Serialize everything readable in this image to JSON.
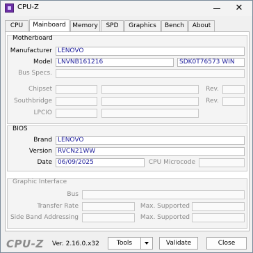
{
  "window": {
    "title": "CPU-Z",
    "close_glyph": "✕"
  },
  "tabs": [
    {
      "label": "CPU"
    },
    {
      "label": "Mainboard"
    },
    {
      "label": "Memory"
    },
    {
      "label": "SPD"
    },
    {
      "label": "Graphics"
    },
    {
      "label": "Bench"
    },
    {
      "label": "About"
    }
  ],
  "motherboard": {
    "title": "Motherboard",
    "manufacturer_label": "Manufacturer",
    "manufacturer": "LENOVO",
    "model_label": "Model",
    "model": "LNVNB161216",
    "model_extra": "SDK0T76573 WIN",
    "bus_specs_label": "Bus Specs.",
    "chipset_label": "Chipset",
    "southbridge_label": "Southbridge",
    "lpcio_label": "LPCIO",
    "rev_label": "Rev."
  },
  "bios": {
    "title": "BIOS",
    "brand_label": "Brand",
    "brand": "LENOVO",
    "version_label": "Version",
    "version": "RVCN21WW",
    "date_label": "Date",
    "date": "06/09/2025",
    "cpu_microcode_label": "CPU Microcode"
  },
  "graphic_interface": {
    "title": "Graphic Interface",
    "bus_label": "Bus",
    "transfer_rate_label": "Transfer Rate",
    "side_band_label": "Side Band Addressing",
    "max_supported_label": "Max. Supported"
  },
  "footer": {
    "logo": "CPU-Z",
    "version": "Ver. 2.16.0.x32",
    "tools_label": "Tools",
    "validate_label": "Validate",
    "close_label": "Close"
  }
}
